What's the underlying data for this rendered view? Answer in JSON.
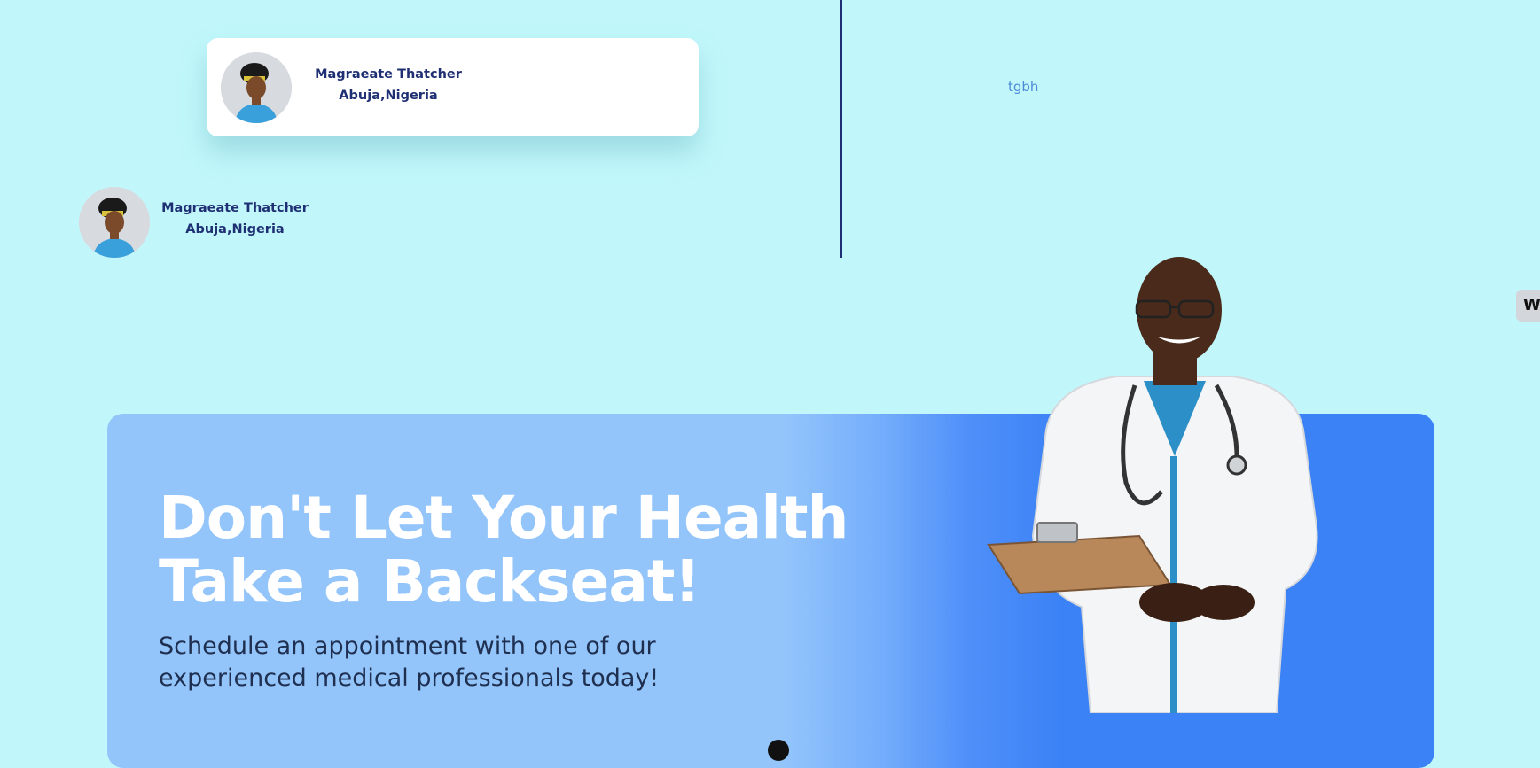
{
  "profile_card": {
    "name": "Magraeate Thatcher",
    "location": "Abuja,Nigeria"
  },
  "profile_plain": {
    "name": "Magraeate Thatcher",
    "location": "Abuja,Nigeria"
  },
  "side_text": "tgbh",
  "edge_tab": {
    "label": "W"
  },
  "hero": {
    "title_line1": "Don't Let Your Health",
    "title_line2": "Take a Backseat!",
    "subtitle_line1": "Schedule an appointment with one of our",
    "subtitle_line2": "experienced medical professionals today!"
  },
  "colors": {
    "page_bg": "#c1f7fb",
    "name_text": "#1f2f73",
    "banner_light": "#93c5fb",
    "banner_dark": "#3b82f6",
    "link_text": "#4d8ad6"
  }
}
